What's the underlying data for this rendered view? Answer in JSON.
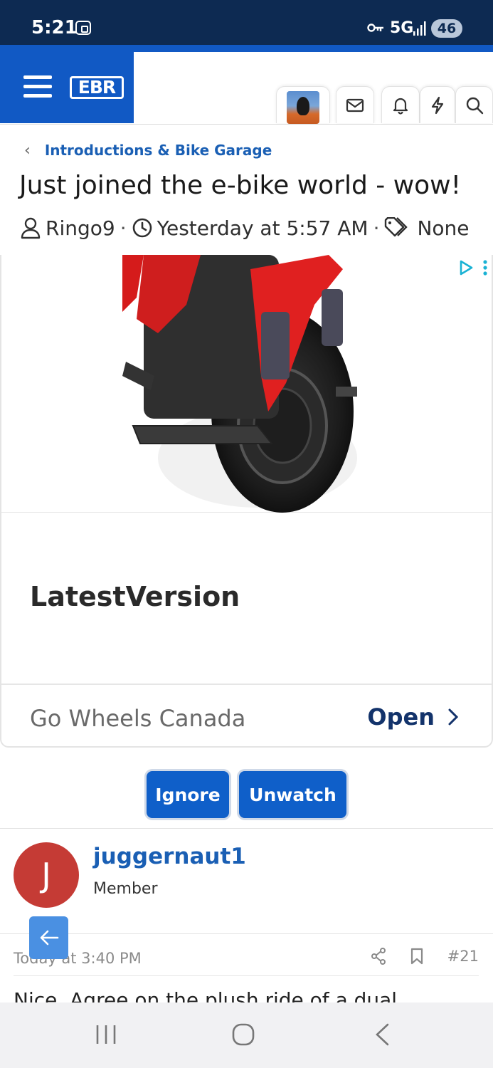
{
  "status_bar": {
    "time": "5:21",
    "network": "5G",
    "battery": "46"
  },
  "header": {
    "logo": "EBR"
  },
  "breadcrumb": {
    "label": "Introductions & Bike Garage"
  },
  "thread": {
    "title": "Just joined the e-bike world - wow!",
    "author": "Ringo9",
    "date": "Yesterday at 5:57 AM",
    "tags": "None"
  },
  "ad": {
    "headline": "LatestVersion",
    "advertiser": "Go Wheels Canada",
    "cta": "Open"
  },
  "actions": {
    "ignore": "Ignore",
    "unwatch": "Unwatch"
  },
  "post": {
    "avatar_letter": "J",
    "username": "juggernaut1",
    "role": "Member",
    "time": "Today at 3:40 PM",
    "number": "#21",
    "body": "Nice. Agree on the plush ride of a dual"
  },
  "icons": {
    "menu": "hamburger-icon",
    "mail": "mail-icon",
    "alerts": "bell-icon",
    "whats_new": "bolt-icon",
    "search": "search-icon",
    "user": "user-icon",
    "clock": "clock-icon",
    "tags": "tag-icon",
    "share": "share-icon",
    "bookmark": "bookmark-icon"
  },
  "colors": {
    "brand": "#1159c4",
    "link": "#1a5fb4",
    "status_bar": "#0d2a52",
    "avatar": "#c53b35"
  }
}
